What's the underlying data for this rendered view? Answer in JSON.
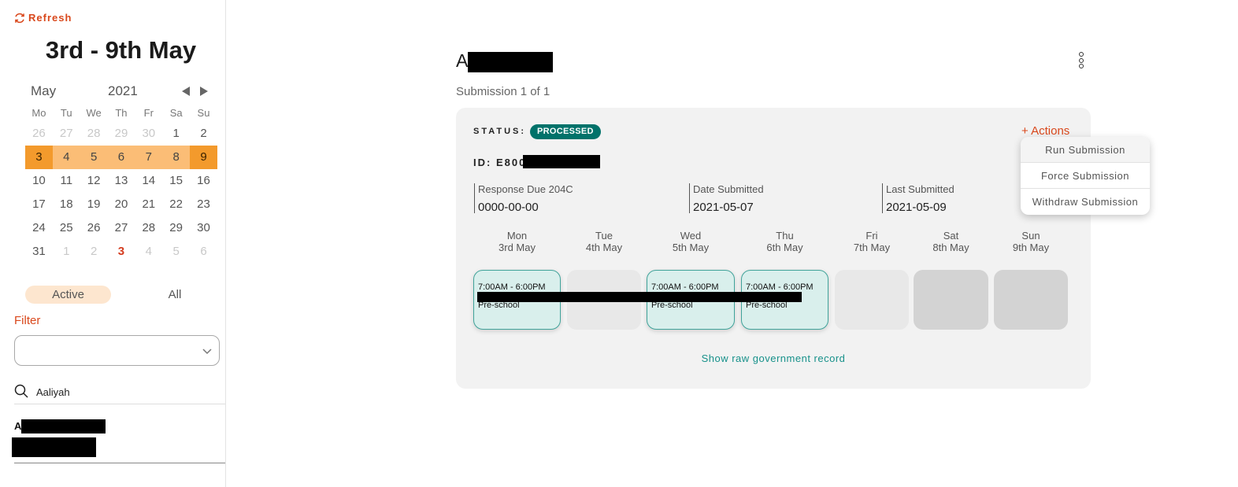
{
  "sidebar": {
    "refresh_label": "Refresh",
    "week_title": "3rd - 9th May",
    "calendar": {
      "month": "May",
      "year": "2021",
      "weekdays": [
        "Mo",
        "Tu",
        "We",
        "Th",
        "Fr",
        "Sa",
        "Su"
      ],
      "weeks": [
        [
          "26",
          "27",
          "28",
          "29",
          "30",
          "1",
          "2"
        ],
        [
          "3",
          "4",
          "5",
          "6",
          "7",
          "8",
          "9"
        ],
        [
          "10",
          "11",
          "12",
          "13",
          "14",
          "15",
          "16"
        ],
        [
          "17",
          "18",
          "19",
          "20",
          "21",
          "22",
          "23"
        ],
        [
          "24",
          "25",
          "26",
          "27",
          "28",
          "29",
          "30"
        ],
        [
          "31",
          "1",
          "2",
          "3",
          "4",
          "5",
          "6"
        ]
      ],
      "selected_week_color": "#fbbd76",
      "selected_week_edge_color": "#f39a2c",
      "today_color": "#d43c1f"
    },
    "toggle": {
      "active": "Active",
      "all": "All"
    },
    "filter_label": "Filter",
    "filter_value": "",
    "search_value": "Aaliyah",
    "list_item_initial": "A"
  },
  "main": {
    "name_initial": "A",
    "submission_count": "Submission 1 of 1",
    "status_label": "STATUS:",
    "status_value": "PROCESSED",
    "status_color": "#00726a",
    "actions_label": "+ Actions",
    "id_prefix": "ID: E800",
    "meta": [
      {
        "label": "Response Due 204C",
        "value": "0000-00-00"
      },
      {
        "label": "Date Submitted",
        "value": "2021-05-07"
      },
      {
        "label": "Last Submitted",
        "value": "2021-05-09"
      }
    ],
    "days": [
      {
        "day": "Mon",
        "date": "3rd May",
        "state": "shift",
        "time": "7:00AM - 6:00PM",
        "program": "Pre-school"
      },
      {
        "day": "Tue",
        "date": "4th May",
        "state": "empty-light",
        "time": "",
        "program": ""
      },
      {
        "day": "Wed",
        "date": "5th May",
        "state": "shift",
        "time": "7:00AM - 6:00PM",
        "program": "Pre-school"
      },
      {
        "day": "Thu",
        "date": "6th May",
        "state": "shift",
        "time": "7:00AM - 6:00PM",
        "program": "Pre-school"
      },
      {
        "day": "Fri",
        "date": "7th May",
        "state": "empty-light",
        "time": "",
        "program": ""
      },
      {
        "day": "Sat",
        "date": "8th May",
        "state": "empty-dark",
        "time": "",
        "program": ""
      },
      {
        "day": "Sun",
        "date": "9th May",
        "state": "empty-dark",
        "time": "",
        "program": ""
      }
    ],
    "raw_record_link": "Show raw government record",
    "accent_color": "#d9481c",
    "link_color": "#17918a"
  },
  "actions_menu": [
    "Run Submission",
    "Force Submission",
    "Withdraw Submission"
  ]
}
